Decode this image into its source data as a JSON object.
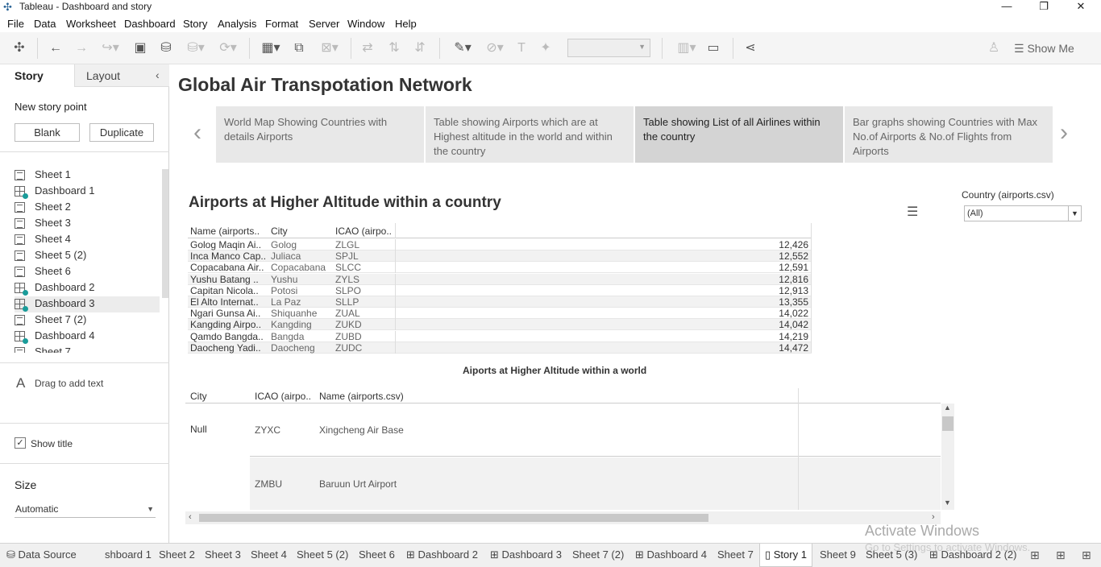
{
  "app": {
    "window_title": "Tableau - Dashboard and story",
    "menu": [
      "File",
      "Data",
      "Worksheet",
      "Dashboard",
      "Story",
      "Analysis",
      "Format",
      "Server",
      "Window",
      "Help"
    ],
    "show_me": "Show Me"
  },
  "sidebar": {
    "tab_story": "Story",
    "tab_layout": "Layout",
    "new_story_point": "New story point",
    "blank_button": "Blank",
    "duplicate_button": "Duplicate",
    "sheets": [
      {
        "label": "Sheet 1",
        "kind": "sheet"
      },
      {
        "label": "Dashboard 1",
        "kind": "dashboard"
      },
      {
        "label": "Sheet 2",
        "kind": "sheet"
      },
      {
        "label": "Sheet 3",
        "kind": "sheet"
      },
      {
        "label": "Sheet 4",
        "kind": "sheet"
      },
      {
        "label": "Sheet 5 (2)",
        "kind": "sheet"
      },
      {
        "label": "Sheet 6",
        "kind": "sheet"
      },
      {
        "label": "Dashboard 2",
        "kind": "dashboard"
      },
      {
        "label": "Dashboard 3",
        "kind": "dashboard"
      },
      {
        "label": "Sheet 7 (2)",
        "kind": "sheet"
      },
      {
        "label": "Dashboard 4",
        "kind": "dashboard"
      },
      {
        "label": "Sheet 7",
        "kind": "sheet"
      }
    ],
    "drag_text": "Drag to add text",
    "show_title": "Show title",
    "size_label": "Size",
    "size_value": "Automatic"
  },
  "story": {
    "title": "Global Air Transpotation Network",
    "points": [
      {
        "caption": "World Map Showing Countries with details Airports",
        "active": false
      },
      {
        "caption": "Table showing Airports which are at Highest altitude in the world and within the country",
        "active": false
      },
      {
        "caption": "Table showing List of all Airlines within the country",
        "active": true
      },
      {
        "caption": "Bar graphs showing Countries with Max No.of Airports & No.of Flights from Airports",
        "active": false
      }
    ]
  },
  "sheet_country": {
    "title": "Airports at Higher Altitude within a country",
    "headers": [
      "Name (airports..",
      "City",
      "ICAO (airpo.."
    ],
    "rows": [
      [
        "Golog Maqin Ai..",
        "Golog",
        "ZLGL",
        "12,426"
      ],
      [
        "Inca Manco Cap..",
        "Juliaca",
        "SPJL",
        "12,552"
      ],
      [
        "Copacabana Air..",
        "Copacabana",
        "SLCC",
        "12,591"
      ],
      [
        "Yushu Batang ..",
        "Yushu",
        "ZYLS",
        "12,816"
      ],
      [
        "Capitan Nicola..",
        "Potosi",
        "SLPO",
        "12,913"
      ],
      [
        "El Alto Internat..",
        "La Paz",
        "SLLP",
        "13,355"
      ],
      [
        "Ngari Gunsa Ai..",
        "Shiquanhe",
        "ZUAL",
        "14,022"
      ],
      [
        "Kangding Airpo..",
        "Kangding",
        "ZUKD",
        "14,042"
      ],
      [
        "Qamdo Bangda..",
        "Bangda",
        "ZUBD",
        "14,219"
      ],
      [
        "Daocheng Yadi..",
        "Daocheng",
        "ZUDC",
        "14,472"
      ]
    ]
  },
  "filter": {
    "label": "Country (airports.csv)",
    "value": "(All)"
  },
  "sheet_world": {
    "title": "Aiports at Higher Altitude within a world",
    "headers": [
      "City",
      "ICAO (airpo..",
      "Name (airports.csv)"
    ],
    "city": "Null",
    "rows": [
      [
        "ZYXC",
        "Xingcheng Air Base"
      ],
      [
        "ZMBU",
        "Baruun Urt Airport"
      ]
    ]
  },
  "bottom_tabs": [
    "Data Source",
    "shboard 1",
    "Sheet 2",
    "Sheet 3",
    "Sheet 4",
    "Sheet 5 (2)",
    "Sheet 6",
    "Dashboard 2",
    "Dashboard 3",
    "Sheet 7 (2)",
    "Dashboard 4",
    "Sheet 7",
    "Story 1",
    "Sheet 9",
    "Sheet 5 (3)",
    "Dashboard 2 (2)"
  ],
  "watermark": {
    "line1": "Activate Windows",
    "line2": "Go to Settings to activate Windows."
  }
}
